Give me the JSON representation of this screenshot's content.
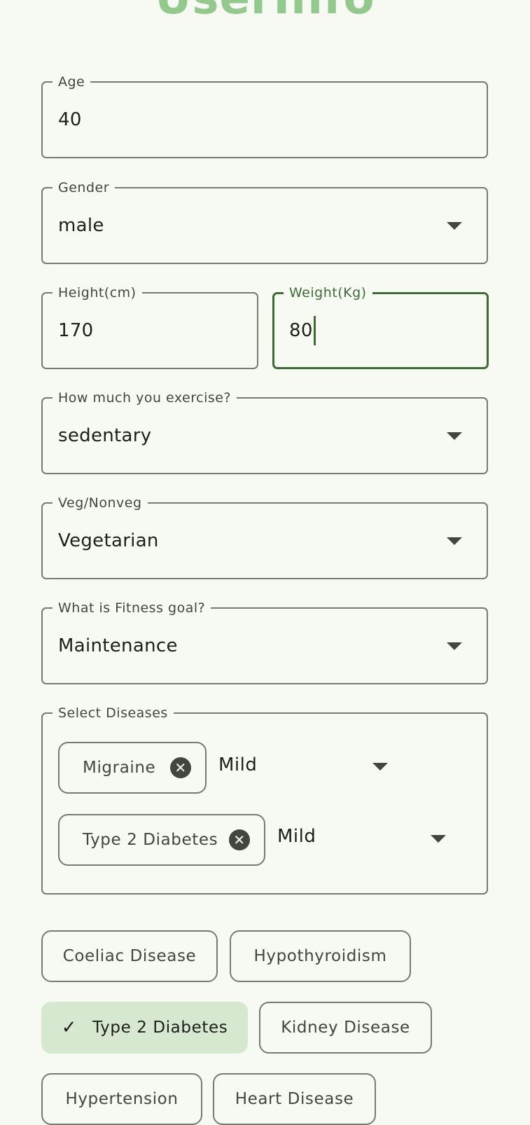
{
  "page": {
    "title": "UserInfo"
  },
  "fields": {
    "age": {
      "label": "Age",
      "value": "40"
    },
    "gender": {
      "label": "Gender",
      "value": "male"
    },
    "height": {
      "label": "Height(cm)",
      "value": "170"
    },
    "weight": {
      "label": "Weight(Kg)",
      "value": "80"
    },
    "exercise": {
      "label": "How much you exercise?",
      "value": "sedentary"
    },
    "diet": {
      "label": "Veg/Nonveg",
      "value": "Vegetarian"
    },
    "goal": {
      "label": "What is Fitness goal?",
      "value": "Maintenance"
    }
  },
  "diseases": {
    "label": "Select Diseases",
    "selected": [
      {
        "name": "Migraine",
        "severity": "Mild"
      },
      {
        "name": "Type 2 Diabetes",
        "severity": "Mild"
      }
    ],
    "options": [
      {
        "label": "Coeliac Disease",
        "selected": false
      },
      {
        "label": "Hypothyroidism",
        "selected": false
      },
      {
        "label": "Type 2 Diabetes",
        "selected": true
      },
      {
        "label": "Kidney Disease",
        "selected": false
      },
      {
        "label": "Hypertension",
        "selected": false
      },
      {
        "label": "Heart Disease",
        "selected": false
      }
    ]
  },
  "icons": {
    "dropdown": "arrow-drop-down-icon",
    "remove": "cancel-icon",
    "check": "check-icon"
  },
  "colors": {
    "background": "#f7faf2",
    "title": "#93c98d",
    "focus": "#3e6b36",
    "selected_chip": "#d6e8cf",
    "outline": "#767b72"
  }
}
